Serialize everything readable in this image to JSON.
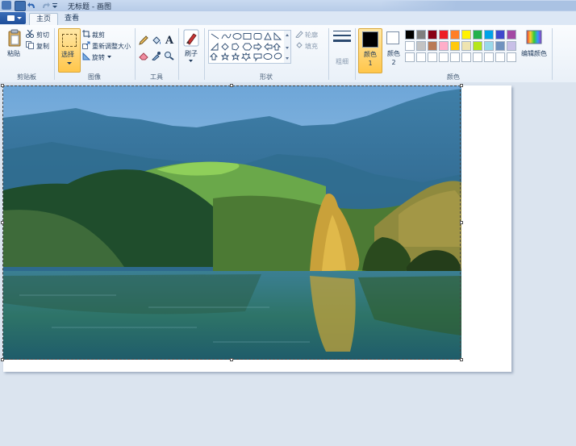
{
  "title_bar": {
    "title": "无标题 - 画图"
  },
  "menu": {
    "tabs": [
      {
        "label": "主页",
        "active": true
      },
      {
        "label": "查看",
        "active": false
      }
    ]
  },
  "ribbon": {
    "clipboard": {
      "paste": "粘贴",
      "cut": "剪切",
      "copy": "复制",
      "group": "剪贴板"
    },
    "image": {
      "select": "选择",
      "crop": "裁剪",
      "resize": "重新调整大小",
      "rotate": "旋转",
      "group": "图像"
    },
    "tools": {
      "group": "工具"
    },
    "brushes": {
      "label": "刷子"
    },
    "shapes": {
      "outline": "轮廓",
      "fill": "填充",
      "group": "形状"
    },
    "size": {
      "label": "粗细"
    },
    "colors": {
      "color1": "颜色 1",
      "color2": "颜色 2",
      "edit": "编辑颜色",
      "group": "颜色",
      "color1_value": "#000000",
      "color2_value": "#ffffff",
      "palette_row1": [
        "#000000",
        "#7f7f7f",
        "#880015",
        "#ed1c24",
        "#ff7f27",
        "#fff200",
        "#22b14c",
        "#00a2e8",
        "#3f48cc",
        "#a349a4"
      ],
      "palette_row2": [
        "#ffffff",
        "#c3c3c3",
        "#b97a57",
        "#ffaec9",
        "#ffc90e",
        "#efe4b0",
        "#b5e61d",
        "#99d9ea",
        "#7092be",
        "#c8bfe7"
      ],
      "palette_row3": [
        "#ffffff",
        "#ffffff",
        "#ffffff",
        "#ffffff",
        "#ffffff",
        "#ffffff",
        "#ffffff",
        "#ffffff",
        "#ffffff",
        "#ffffff"
      ]
    }
  },
  "canvas": {
    "content": "landscape photo",
    "background": "#ffffff"
  }
}
